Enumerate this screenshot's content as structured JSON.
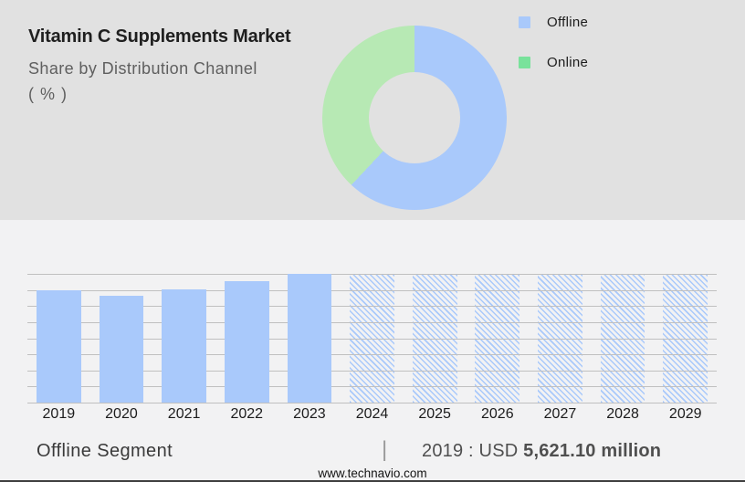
{
  "header": {
    "title": "Vitamin C Supplements Market",
    "subtitle": "Share by Distribution Channel",
    "unit_label": "( % )"
  },
  "donut": {
    "type": "donut",
    "legend_position": "right",
    "segments": [
      {
        "label": "Offline",
        "share_pct": 62,
        "slice_color": "#a9c9fb",
        "swatch_color": "#a9c9fb"
      },
      {
        "label": "Online",
        "share_pct": 38,
        "slice_color": "#b7e9b4",
        "swatch_color": "#79e29b"
      }
    ]
  },
  "chart_data": {
    "type": "bar",
    "categories": [
      "2019",
      "2020",
      "2021",
      "2022",
      "2023",
      "2024",
      "2025",
      "2026",
      "2027",
      "2028",
      "2029"
    ],
    "values_pct_height": [
      87,
      83,
      88,
      94,
      100,
      100,
      100,
      100,
      100,
      100,
      100
    ],
    "forecast_start_index": 5,
    "forecast_style": "hatched-diagonal",
    "bar_color": "#a9c9fb",
    "gridline_count": 9,
    "y_axis_labels_visible": false,
    "known_values": {
      "2019": "USD 5,621.10 million"
    }
  },
  "footer": {
    "segment_label": "Offline Segment",
    "separator": "|",
    "value_prefix": "2019 : USD ",
    "value_bold": "5,621.10 million",
    "website": "www.technavio.com"
  },
  "colors": {
    "top_bg": "#e1e1e1",
    "bottom_bg": "#f2f2f3",
    "grid": "#c0c0c0",
    "title_text": "#1f1f1f",
    "muted_text": "#5f5f5f",
    "axis_text": "#1c1c1c",
    "footer_text": "#3a3a3a",
    "value_text": "#4f4f4f",
    "separator": "#9a9a9a",
    "bottom_border": "#3e3e3e"
  }
}
